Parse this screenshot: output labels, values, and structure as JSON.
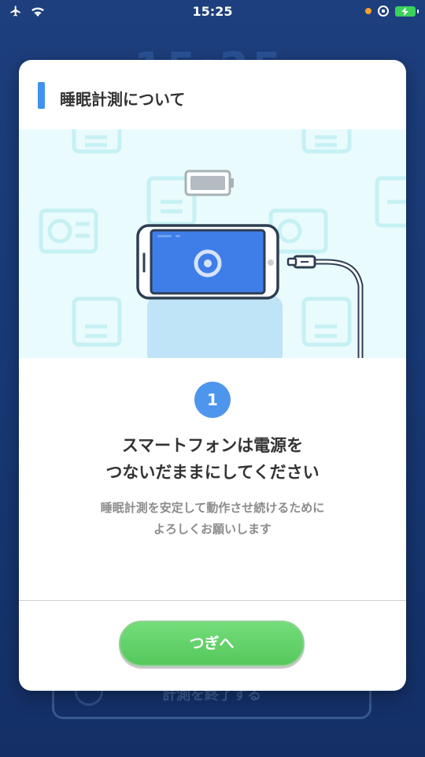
{
  "status_bar": {
    "time": "15:25"
  },
  "background": {
    "clock": "15:25",
    "button_label": "計測を終了する"
  },
  "modal": {
    "title": "睡眠計測について",
    "step_number": "1",
    "heading_line1": "スマートフォンは電源を",
    "heading_line2": "つないだままにしてください",
    "description_line1": "睡眠計測を安定して動作させ続けるために",
    "description_line2": "よろしくお願いします",
    "next_button": "つぎへ"
  },
  "colors": {
    "accent_blue": "#3f92f0",
    "button_green": "#5cd163",
    "illustration_bg": "#eafbfd",
    "phone_screen": "#3f7ee8"
  },
  "icons": [
    "airplane-icon",
    "wifi-icon",
    "orientation-lock-icon",
    "battery-charging-icon",
    "battery-icon",
    "phone-icon",
    "charging-cable-icon"
  ]
}
